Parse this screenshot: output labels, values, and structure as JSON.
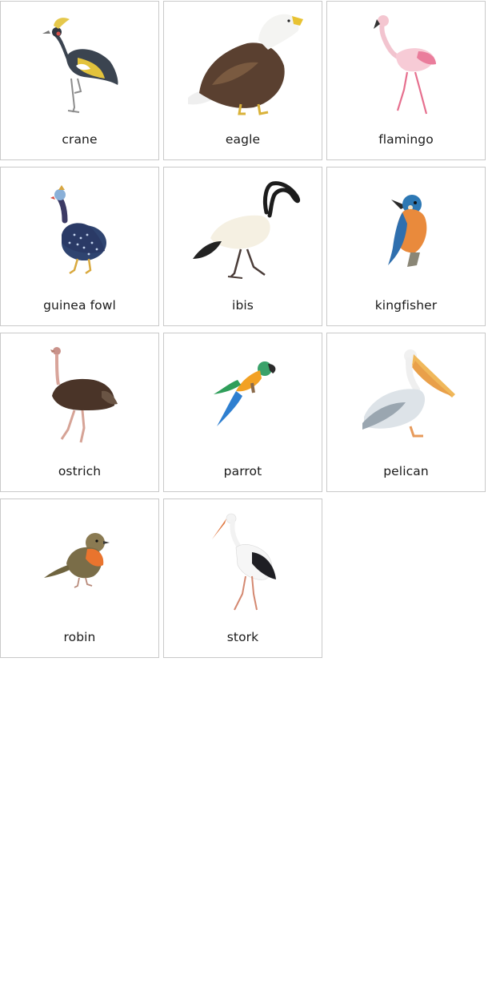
{
  "cards": [
    {
      "label": "crane",
      "icon": "crane-icon"
    },
    {
      "label": "eagle",
      "icon": "eagle-icon"
    },
    {
      "label": "flamingo",
      "icon": "flamingo-icon"
    },
    {
      "label": "guinea fowl",
      "icon": "guinea-fowl-icon"
    },
    {
      "label": "ibis",
      "icon": "ibis-icon"
    },
    {
      "label": "kingfisher",
      "icon": "kingfisher-icon"
    },
    {
      "label": "ostrich",
      "icon": "ostrich-icon"
    },
    {
      "label": "parrot",
      "icon": "parrot-icon"
    },
    {
      "label": "pelican",
      "icon": "pelican-icon"
    },
    {
      "label": "robin",
      "icon": "robin-icon"
    },
    {
      "label": "stork",
      "icon": "stork-icon"
    }
  ]
}
